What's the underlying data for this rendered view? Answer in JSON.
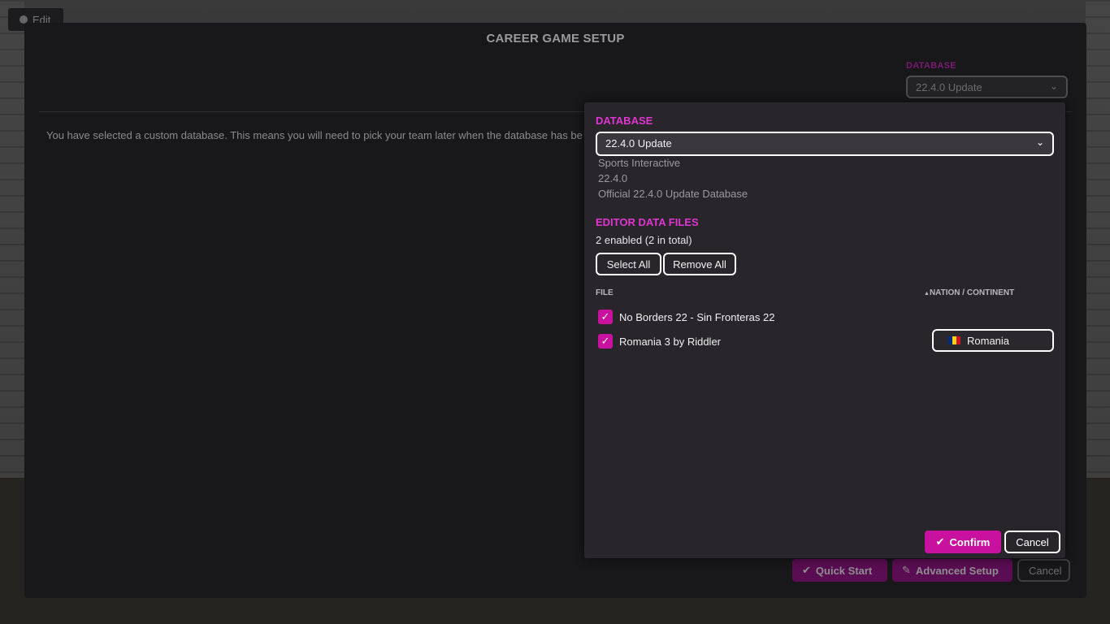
{
  "top": {
    "edit_label": "Edit"
  },
  "modal": {
    "title": "CAREER GAME SETUP",
    "database_label": "DATABASE",
    "database_value": "22.4.0 Update",
    "custom_message": "You have selected a custom database. This means you will need to pick your team later when the database has been",
    "buttons": {
      "quick_start": "Quick Start",
      "advanced_setup": "Advanced Setup",
      "cancel": "Cancel"
    }
  },
  "popup": {
    "database_label": "DATABASE",
    "database_value": "22.4.0 Update",
    "db_info": {
      "author": "Sports Interactive",
      "version": "22.4.0",
      "description": "Official 22.4.0 Update Database"
    },
    "editor_files_label": "EDITOR DATA FILES",
    "enabled_count": "2 enabled (2 in total)",
    "select_all": "Select All",
    "remove_all": "Remove All",
    "columns": {
      "file": "FILE",
      "nation": "NATION / CONTINENT",
      "sort_indicator": "▲"
    },
    "files": [
      {
        "name": "No Borders 22 - Sin Fronteras 22",
        "checked": true,
        "nation": ""
      },
      {
        "name": "Romania 3 by Riddler",
        "checked": true,
        "nation": "Romania"
      }
    ],
    "confirm": "Confirm",
    "cancel": "Cancel"
  },
  "colors": {
    "accent": "#c8119e",
    "label_pink": "#e034d3"
  },
  "icons": {
    "check": "check-icon",
    "chevron": "chevron-down-icon",
    "pencil": "pencil-icon",
    "flag": "romania-flag-icon"
  }
}
